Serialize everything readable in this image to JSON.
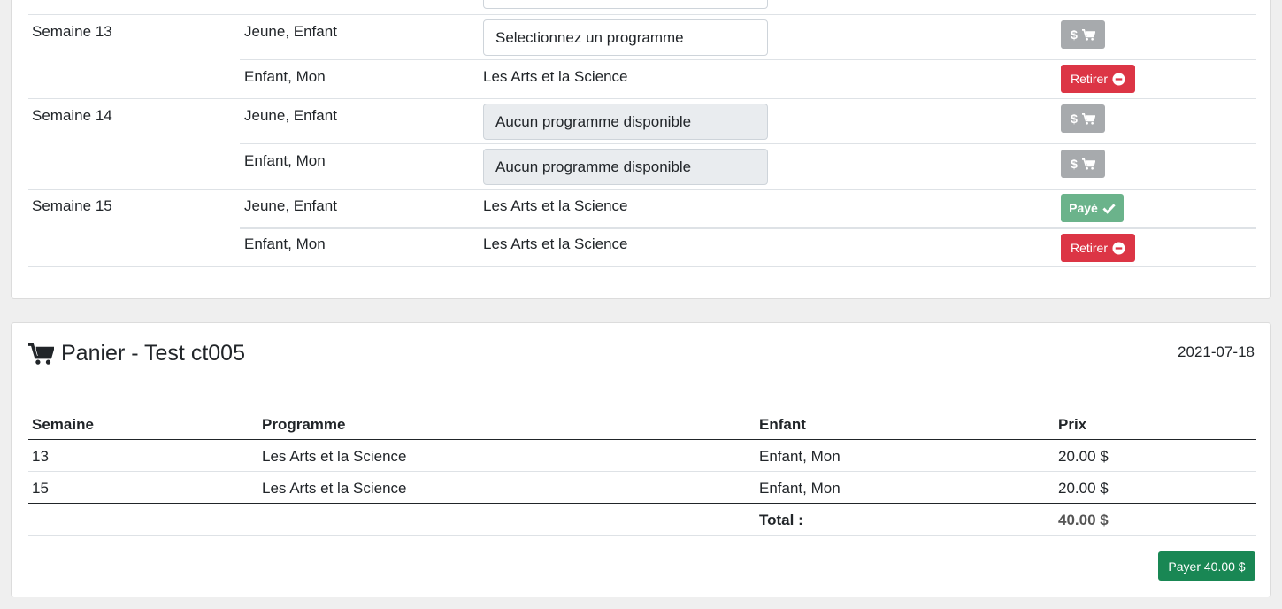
{
  "schedule": {
    "rows": [
      {
        "week": "Semaine 13",
        "child": "Jeune, Enfant",
        "select": "Selectionnez un programme",
        "action": "$"
      },
      {
        "week": "",
        "child": "Enfant, Mon",
        "program": "Les Arts et la Science",
        "action": "Retirer"
      },
      {
        "week": "Semaine 14",
        "child": "Jeune, Enfant",
        "select": "Aucun programme disponible",
        "action": "$"
      },
      {
        "week": "",
        "child": "Enfant, Mon",
        "select": "Aucun programme disponible",
        "action": "$"
      },
      {
        "week": "Semaine 15",
        "child": "Jeune, Enfant",
        "program": "Les Arts et la Science",
        "action": "Payé"
      },
      {
        "week": "",
        "child": "Enfant, Mon",
        "program": "Les Arts et la Science",
        "action": "Retirer"
      }
    ]
  },
  "cart": {
    "title": "Panier - Test ct005",
    "date": "2021-07-18",
    "headers": {
      "week": "Semaine",
      "program": "Programme",
      "child": "Enfant",
      "price": "Prix"
    },
    "items": [
      {
        "week": "13",
        "program": "Les Arts et la Science",
        "child": "Enfant, Mon",
        "price": "20.00 $"
      },
      {
        "week": "15",
        "program": "Les Arts et la Science",
        "child": "Enfant, Mon",
        "price": "20.00 $"
      }
    ],
    "total_label": "Total :",
    "total_value": "40.00 $",
    "pay_button": "Payer 40.00 $"
  },
  "colors": {
    "danger": "#dc3545",
    "success": "#198754",
    "paid": "#6bb38b",
    "disabled": "#a7aaad"
  },
  "icons": [
    "cart-icon",
    "minus-circle-icon",
    "check-icon",
    "shopping-cart-icon"
  ]
}
